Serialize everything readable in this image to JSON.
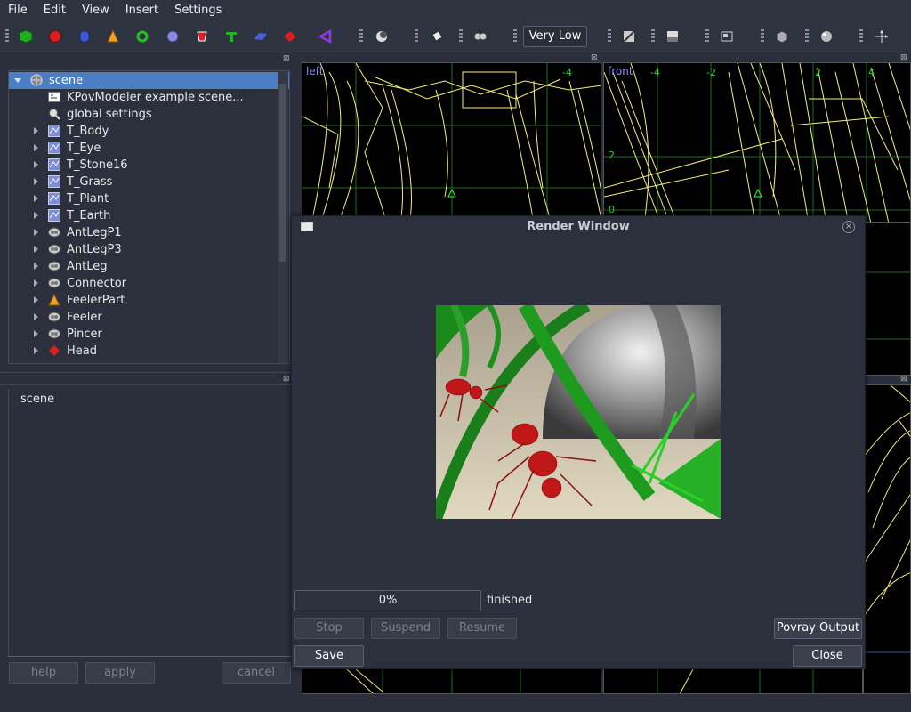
{
  "menu": [
    "File",
    "Edit",
    "View",
    "Insert",
    "Settings"
  ],
  "toolbar": {
    "icons": [
      {
        "name": "box-icon",
        "color": "#1fae1f"
      },
      {
        "name": "sphere-icon",
        "color": "#d91f1f"
      },
      {
        "name": "cylinder-icon",
        "color": "#3f57d8"
      },
      {
        "name": "cone-icon",
        "color": "#f0a020"
      },
      {
        "name": "torus-icon",
        "color": "#22c022"
      },
      {
        "name": "blob-icon",
        "color": "#8a8ae0"
      },
      {
        "name": "lathe-icon",
        "color": "#d91f1f"
      },
      {
        "name": "prism-icon",
        "color": "#22b422"
      },
      {
        "name": "plane-icon",
        "color": "#4a5ee0"
      },
      {
        "name": "disc-icon",
        "color": "#d91f1f"
      },
      {
        "name": "triangle-icon",
        "color": "#8a3ae0"
      }
    ],
    "quality": "Very Low"
  },
  "tree": {
    "items": [
      {
        "label": "scene",
        "icon": "scene-icon",
        "expanded": true,
        "selected": true
      },
      {
        "label": "KPovModeler example scene...",
        "icon": "comment-icon"
      },
      {
        "label": "global settings",
        "icon": "settings-icon"
      },
      {
        "label": "T_Body",
        "icon": "texture-icon"
      },
      {
        "label": "T_Eye",
        "icon": "texture-icon"
      },
      {
        "label": "T_Stone16",
        "icon": "texture-icon"
      },
      {
        "label": "T_Grass",
        "icon": "texture-icon"
      },
      {
        "label": "T_Plant",
        "icon": "texture-icon"
      },
      {
        "label": "T_Earth",
        "icon": "texture-icon"
      },
      {
        "label": "AntLegP1",
        "icon": "declare-icon"
      },
      {
        "label": "AntLegP3",
        "icon": "declare-icon"
      },
      {
        "label": "AntLeg",
        "icon": "declare-icon"
      },
      {
        "label": "Connector",
        "icon": "declare-icon"
      },
      {
        "label": "FeelerPart",
        "icon": "cone-icon"
      },
      {
        "label": "Feeler",
        "icon": "declare-icon"
      },
      {
        "label": "Pincer",
        "icon": "declare-icon"
      },
      {
        "label": "Head",
        "icon": "disc-icon"
      }
    ]
  },
  "properties": {
    "title": "scene",
    "help": "help",
    "apply": "apply",
    "cancel": "cancel"
  },
  "views": {
    "left": "left",
    "front": "front",
    "front_ticks": [
      "-4",
      "-2",
      "2",
      "4"
    ],
    "left_ticks": [
      "-4"
    ],
    "y_ticks": [
      "2",
      "0"
    ]
  },
  "render": {
    "title": "Render Window",
    "progress_percent": 0,
    "progress_text": "0%",
    "status": "finished",
    "stop": "Stop",
    "suspend": "Suspend",
    "resume": "Resume",
    "povray_output": "Povray Output",
    "save": "Save",
    "close": "Close"
  }
}
